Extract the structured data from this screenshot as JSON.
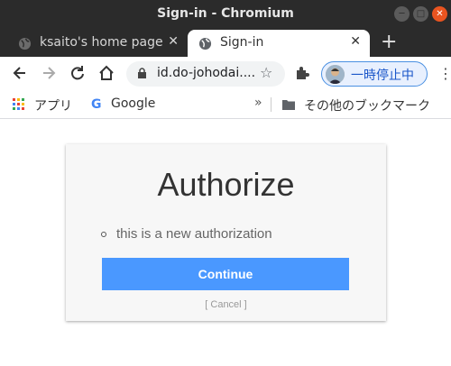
{
  "window": {
    "title": "Sign-in - Chromium",
    "controls": {
      "minimize_glyph": "─",
      "maximize_glyph": "□",
      "close_glyph": "✕"
    }
  },
  "tabs": [
    {
      "label": "ksaito's home page",
      "icon": "globe-icon",
      "active": false,
      "close_glyph": "✕"
    },
    {
      "label": "Sign-in",
      "icon": "globe-icon",
      "active": true,
      "close_glyph": "✕"
    }
  ],
  "new_tab_glyph": "+",
  "toolbar": {
    "url": "id.do-johodai....",
    "profile_label": "一時停止中",
    "star_glyph": "☆",
    "menu_glyph": "⋮"
  },
  "bookmarks": {
    "apps_label": "アプリ",
    "google_label": "Google",
    "more_glyph": "»",
    "other_label": "その他のブックマーク"
  },
  "page": {
    "title": "Authorize",
    "scopes": [
      "this is a new authorization"
    ],
    "continue_label": "Continue",
    "cancel_label": "[ Cancel ]"
  },
  "colors": {
    "continue_button": "#4a98ff",
    "titlebar": "#2b2b2b",
    "close_button": "#e95420",
    "profile_accent": "#1a56c9"
  }
}
